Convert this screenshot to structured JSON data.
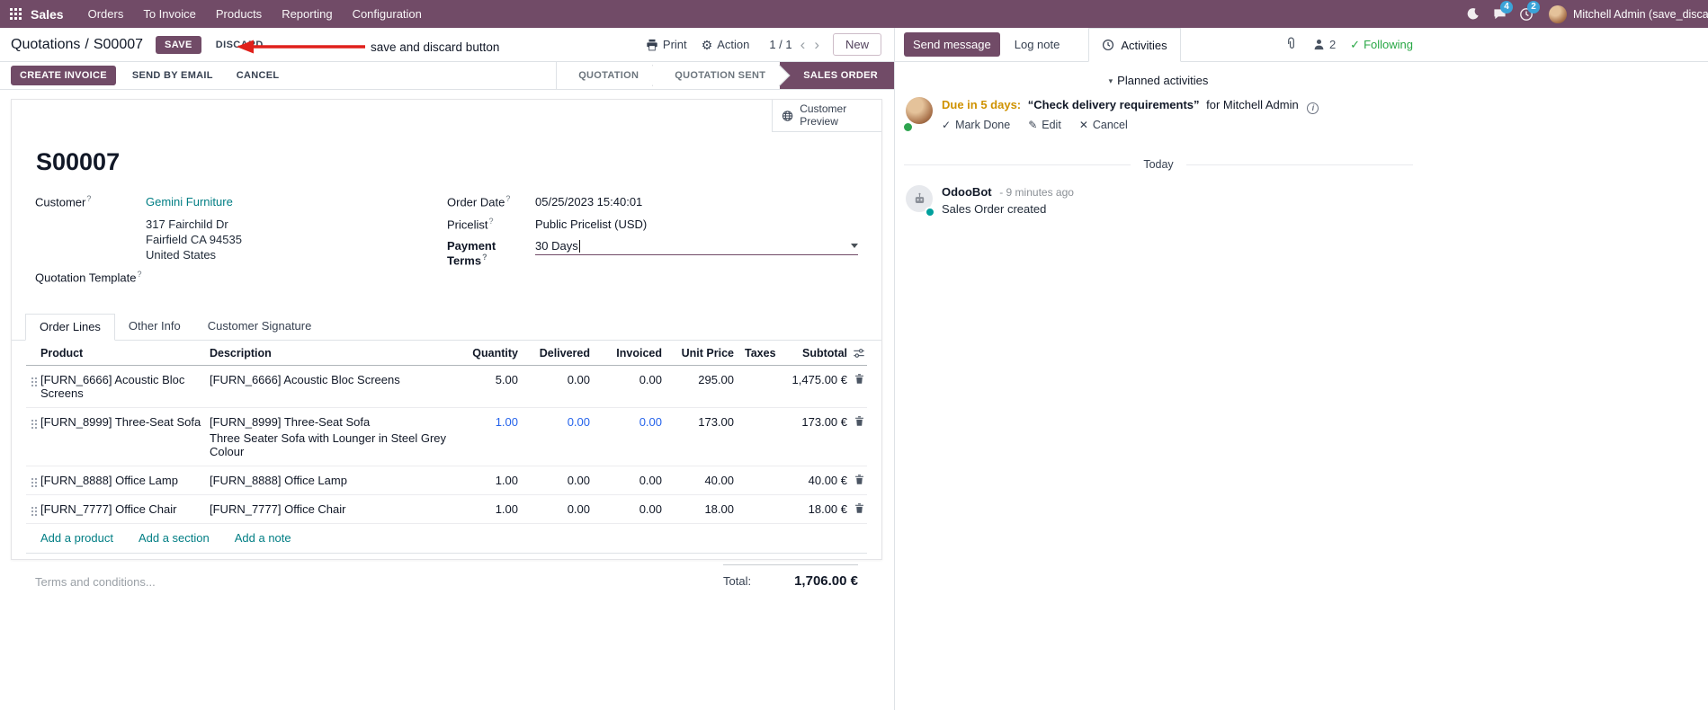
{
  "colors": {
    "primary": "#714B67",
    "link_teal": "#017e84",
    "modified_blue": "#2563eb",
    "warning_orange": "#cf9200",
    "success_green": "#28a745",
    "annotation_red": "#e0201b",
    "badge_blue": "#3ba3d8"
  },
  "navbar": {
    "app_name": "Sales",
    "menus": [
      "Orders",
      "To Invoice",
      "Products",
      "Reporting",
      "Configuration"
    ],
    "messages_badge": "4",
    "activities_badge": "2",
    "user_name": "Mitchell Admin (save_discar"
  },
  "control_panel": {
    "breadcrumb_parent": "Quotations",
    "separator": "/",
    "record_name": "S00007",
    "save": "SAVE",
    "discard": "DISCARD",
    "print": "Print",
    "action": "Action",
    "pager": "1 / 1",
    "prev": "‹",
    "next": "›",
    "new": "New"
  },
  "annotation": {
    "text": "save and discard button"
  },
  "status_bar": {
    "buttons": [
      "CREATE INVOICE",
      "SEND BY EMAIL",
      "CANCEL"
    ],
    "stages": [
      "QUOTATION",
      "QUOTATION SENT",
      "SALES ORDER"
    ],
    "active_stage": "SALES ORDER"
  },
  "form": {
    "customer_preview": "Customer Preview",
    "help_marker": "?",
    "name": "S00007",
    "fields": {
      "customer_label": "Customer",
      "customer_value": "Gemini Furniture",
      "address_line1": "317 Fairchild Dr",
      "address_line2": "Fairfield CA 94535",
      "address_line3": "United States",
      "quotation_template_label": "Quotation Template",
      "order_date_label": "Order Date",
      "order_date_value": "05/25/2023 15:40:01",
      "pricelist_label": "Pricelist",
      "pricelist_value": "Public Pricelist (USD)",
      "payment_terms_label": "Payment Terms",
      "payment_terms_value": "30 Days"
    },
    "tabs": {
      "order_lines": "Order Lines",
      "other_info": "Other Info",
      "customer_signature": "Customer Signature"
    },
    "table": {
      "headers": {
        "product": "Product",
        "description": "Description",
        "quantity": "Quantity",
        "delivered": "Delivered",
        "invoiced": "Invoiced",
        "unit_price": "Unit Price",
        "taxes": "Taxes",
        "subtotal": "Subtotal"
      },
      "rows": [
        {
          "product": "[FURN_6666] Acoustic Bloc Screens",
          "description": "[FURN_6666] Acoustic Bloc Screens",
          "description_note": "",
          "quantity": "5.00",
          "delivered": "0.00",
          "invoiced": "0.00",
          "unit_price": "295.00",
          "taxes": "",
          "subtotal": "1,475.00 €"
        },
        {
          "product": "[FURN_8999] Three-Seat Sofa",
          "description": "[FURN_8999] Three-Seat Sofa",
          "description_note": "Three Seater Sofa with Lounger in Steel Grey Colour",
          "quantity": "1.00",
          "delivered": "0.00",
          "invoiced": "0.00",
          "unit_price": "173.00",
          "taxes": "",
          "subtotal": "173.00 €"
        },
        {
          "product": "[FURN_8888] Office Lamp",
          "description": "[FURN_8888] Office Lamp",
          "description_note": "",
          "quantity": "1.00",
          "delivered": "0.00",
          "invoiced": "0.00",
          "unit_price": "40.00",
          "taxes": "",
          "subtotal": "40.00 €"
        },
        {
          "product": "[FURN_7777] Office Chair",
          "description": "[FURN_7777] Office Chair",
          "description_note": "",
          "quantity": "1.00",
          "delivered": "0.00",
          "invoiced": "0.00",
          "unit_price": "18.00",
          "taxes": "",
          "subtotal": "18.00 €"
        }
      ],
      "add_product": "Add a product",
      "add_section": "Add a section",
      "add_note": "Add a note"
    },
    "terms_placeholder": "Terms and conditions...",
    "total_label": "Total:",
    "total_value": "1,706.00 €"
  },
  "chatter": {
    "send_message": "Send message",
    "log_note": "Log note",
    "activities": "Activities",
    "followers_count": "2",
    "following": "Following",
    "planned_activities": "Planned activities",
    "activity": {
      "due": "Due in 5 days:",
      "summary": "“Check delivery requirements”",
      "assignee": "for Mitchell Admin",
      "mark_done": "Mark Done",
      "edit": "Edit",
      "cancel": "Cancel"
    },
    "today": "Today",
    "message": {
      "author": "OdooBot",
      "timestamp": "- 9 minutes ago",
      "body": "Sales Order created"
    }
  }
}
